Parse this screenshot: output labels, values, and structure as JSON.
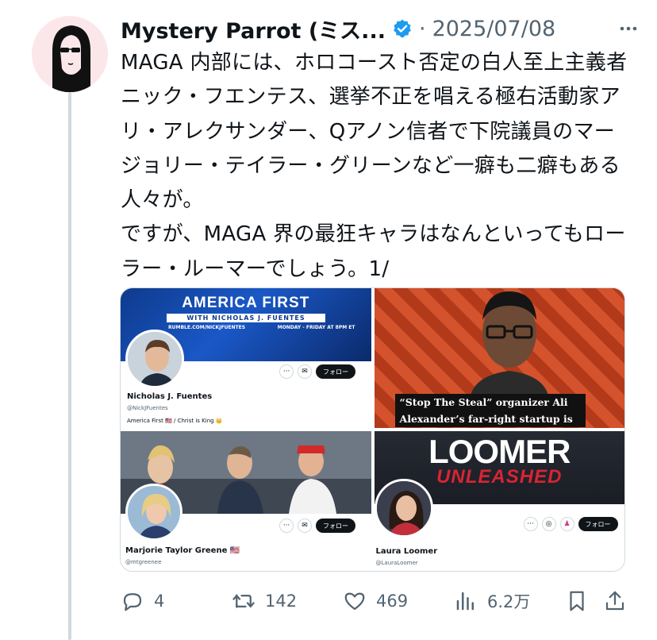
{
  "author": {
    "display_name": "Mystery Parrot (ミス...",
    "verified_icon": "verified-badge-icon",
    "dot": "·",
    "date": "2025/07/08",
    "avatar_icon": "woman-with-sunglasses-illustration"
  },
  "more_label": "···",
  "tweet": {
    "paragraphs": [
      "MAGA 内部には、ホロコースト否定の白人至上主義者ニック・フエンテス、選挙不正を唱える極右活動家アリ・アレクサンダー、Qアノン信者で下院議員のマージョリー・テイラー・グリーンなど一癖も二癖もある人々が。",
      "ですが、MAGA 界の最狂キャラはなんといってもローラー・ルーマーでしょう。1/"
    ]
  },
  "media": {
    "tile1": {
      "banner_title": "AMERICA FIRST",
      "banner_subtitle": "WITH NICHOLAS J. FUENTES",
      "banner_info_left": "RUMBLE.COM/NICKJFUENTES",
      "banner_info_right": "MONDAY - FRIDAY AT 8PM ET",
      "name": "Nicholas J. Fuentes",
      "handle": "@NickJFuentes",
      "bio": "America First 🇺🇸 / Christ is King 👑",
      "follow": "フォロー",
      "more": "···",
      "mail": "✉"
    },
    "tile2": {
      "caption_line1": "“Stop The Steal” organizer Ali",
      "caption_line2": "Alexander’s far-right startup is"
    },
    "tile3": {
      "name": "Marjorie Taylor Greene 🇺🇸",
      "handle": "@mtgreenee",
      "follow": "フォロー",
      "more": "···",
      "mail": "✉"
    },
    "tile4": {
      "banner_title": "LOOMER",
      "banner_subtitle": "UNLEASHED",
      "name": "Laura Loomer",
      "handle": "@LauraLoomer",
      "follow": "フォロー",
      "more": "···"
    }
  },
  "actions": {
    "reply_count": "4",
    "retweet_count": "142",
    "like_count": "469",
    "views_count": "6.2万"
  },
  "colors": {
    "verified": "#1d9bf0",
    "muted": "#536471",
    "border": "#cfd9de",
    "text": "#0f1419"
  }
}
